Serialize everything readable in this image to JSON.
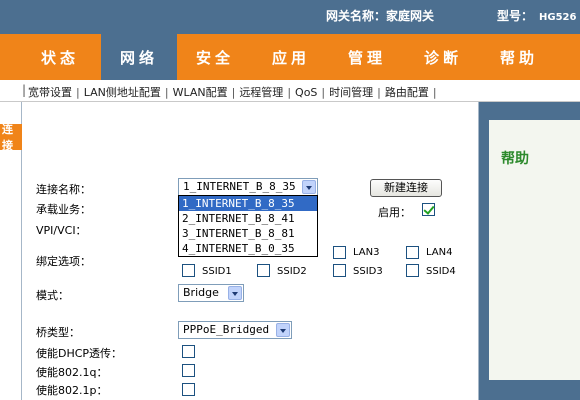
{
  "header": {
    "gateway_label": "网关名称：",
    "gateway_name": "家庭网关",
    "model_label": "型号：",
    "model_value": "HG526"
  },
  "main_nav": {
    "tabs": [
      {
        "label": "状态",
        "active": false
      },
      {
        "label": "网络",
        "active": true
      },
      {
        "label": "安全",
        "active": false
      },
      {
        "label": "应用",
        "active": false
      },
      {
        "label": "管理",
        "active": false
      },
      {
        "label": "诊断",
        "active": false
      },
      {
        "label": "帮助",
        "active": false
      }
    ]
  },
  "sub_nav": {
    "items": [
      "宽带设置",
      "LAN侧地址配置",
      "WLAN配置",
      "远程管理",
      "QoS",
      "时间管理",
      "路由配置"
    ]
  },
  "left_tab": {
    "label": "连接"
  },
  "help_panel": {
    "title": "帮助"
  },
  "form": {
    "connection_name": {
      "label": "连接名称：",
      "value": "1_INTERNET_B_8_35",
      "options": [
        "1_INTERNET_B_8_35",
        "2_INTERNET_B_8_41",
        "3_INTERNET_B_8_81",
        "4_INTERNET_B_0_35"
      ],
      "selected_index": 0
    },
    "new_connection_button": "新建连接",
    "enable": {
      "label": "启用：",
      "checked": true
    },
    "service_label": "承载业务：",
    "vpi_vci_label": "VPI/VCI：",
    "binding": {
      "label": "绑定选项：",
      "options": [
        {
          "label": "LAN3",
          "checked": false
        },
        {
          "label": "LAN4",
          "checked": false
        },
        {
          "label": "SSID1",
          "checked": false
        },
        {
          "label": "SSID2",
          "checked": false
        },
        {
          "label": "SSID3",
          "checked": false
        },
        {
          "label": "SSID4",
          "checked": false
        }
      ]
    },
    "mode": {
      "label": "模式：",
      "value": "Bridge"
    },
    "bridge_type": {
      "label": "桥类型：",
      "value": "PPPoE_Bridged"
    },
    "dhcp_passthrough": {
      "label": "使能DHCP透传：",
      "checked": false
    },
    "enable_8021q": {
      "label": "使能802.1q：",
      "checked": false
    },
    "enable_8021p": {
      "label": "使能802.1p：",
      "checked": false
    }
  },
  "colors": {
    "header_blue": "#4c6f90",
    "nav_orange": "#f08419",
    "help_green": "#2c8a2c",
    "selection_blue": "#316ac5"
  }
}
